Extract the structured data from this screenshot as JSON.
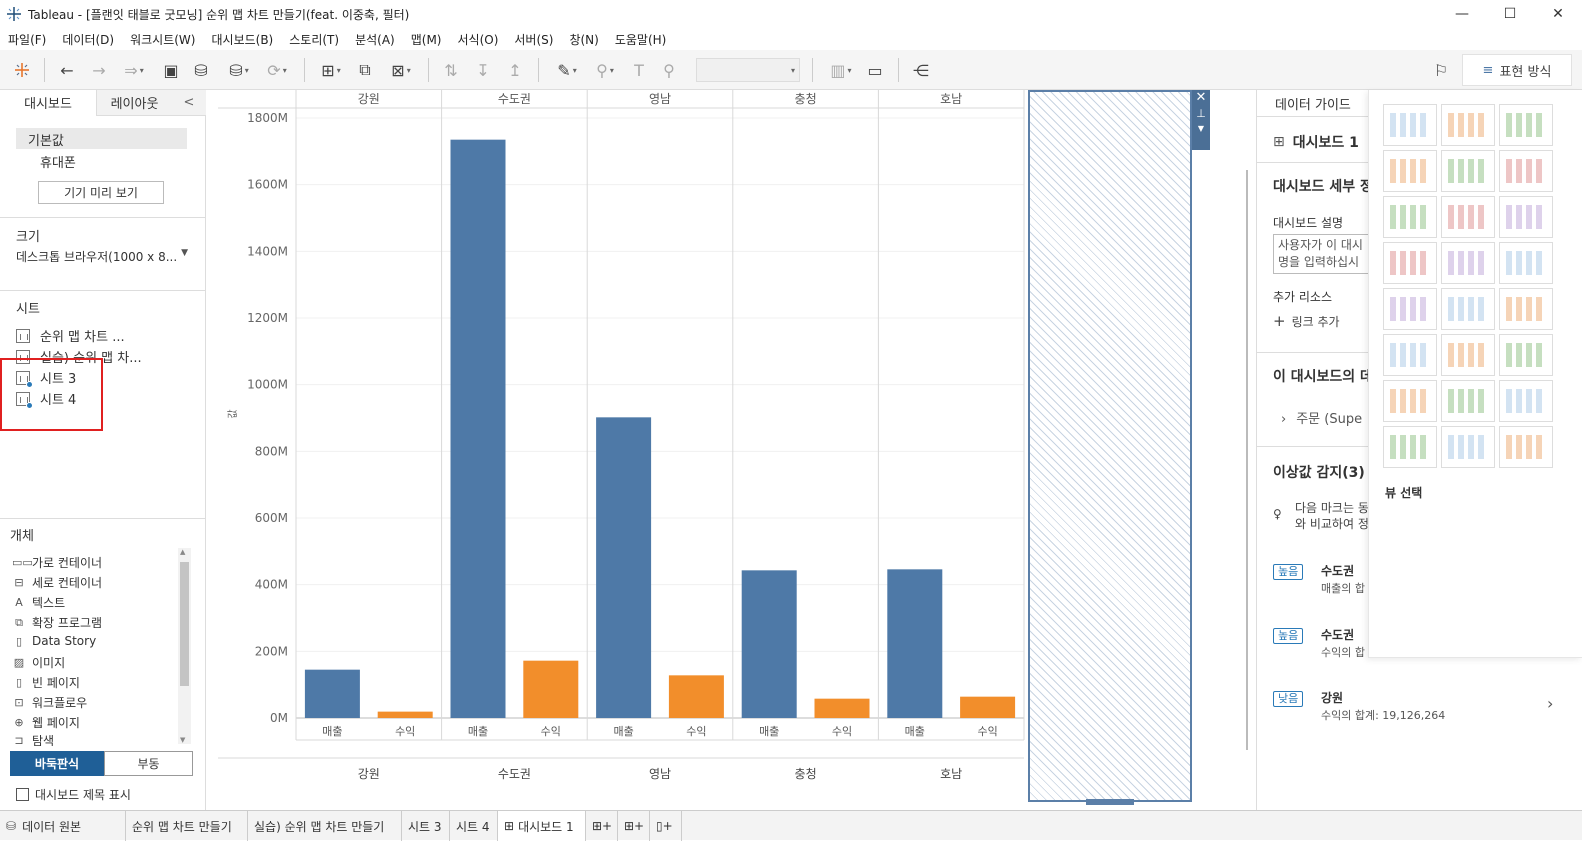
{
  "window": {
    "title": "Tableau - [플랜잇 태블로 굿모닝] 순위 맵 차트 만들기(feat. 이중축, 필터)",
    "min": "—",
    "max": "☐",
    "close": "✕"
  },
  "menu": [
    "파일(F)",
    "데이터(D)",
    "워크시트(W)",
    "대시보드(B)",
    "스토리(T)",
    "분석(A)",
    "맵(M)",
    "서식(O)",
    "서버(S)",
    "창(N)",
    "도움말(H)"
  ],
  "toolbar": {
    "show_me_label": "표현 방식"
  },
  "left": {
    "tab_dashboard": "대시보드",
    "tab_layout": "레이아웃",
    "collapse": "<",
    "device_default": "기본값",
    "device_phone": "휴대폰",
    "device_preview": "기기 미리 보기",
    "size_title": "크기",
    "size_value": "데스크톱 브라우저(1000 x 8...",
    "sheets_title": "시트",
    "sheets": [
      "순위 맵 차트 ...",
      "실습) 순위 맵 차...",
      "시트 3",
      "시트 4"
    ],
    "objects_title": "개체",
    "objects": [
      "가로 컨테이너",
      "세로 컨테이너",
      "텍스트",
      "확장 프로그램",
      "Data Story",
      "이미지",
      "빈 페이지",
      "워크플로우",
      "웹 페이지",
      "탐색"
    ],
    "tiled": "바둑판식",
    "floating": "부동",
    "show_title": "대시보드 제목 표시"
  },
  "chart_data": {
    "type": "bar",
    "categories": [
      "강원",
      "수도권",
      "영남",
      "충청",
      "호남"
    ],
    "subcategories": [
      "매출",
      "수익"
    ],
    "series": [
      {
        "name": "매출",
        "values": [
          145,
          1735,
          902,
          443,
          446
        ]
      },
      {
        "name": "수익",
        "values": [
          19.1,
          172,
          128,
          58,
          64
        ]
      }
    ],
    "y_tick_labels": [
      "0M",
      "200M",
      "400M",
      "600M",
      "800M",
      "1000M",
      "1200M",
      "1400M",
      "1600M",
      "1800M"
    ],
    "ylim": [
      0,
      1800
    ],
    "ylabel": "값",
    "colors": {
      "매출": "#4e79a7",
      "수익": "#f28e2b"
    },
    "grid": true
  },
  "right": {
    "data_guide": "데이터 가이드",
    "dashboard_name": "대시보드 1",
    "details_title": "대시보드 세부 정",
    "desc_label": "대시보드 설명",
    "desc_placeholder_1": "사용자가 이 대시",
    "desc_placeholder_2": "명을 입력하십시",
    "resources": "추가 리소스",
    "add_link": "링크 추가",
    "data_in_dash": "이 대시보드의 데",
    "data_source": "주문 (Supe",
    "outliers_title": "이상값 감지(3)",
    "outlier_hint_1": "다음 마크는 동",
    "outlier_hint_2": "와 비교하여 정",
    "outliers": [
      {
        "badge": "높음",
        "name": "수도권",
        "detail": "매출의 합"
      },
      {
        "badge": "높음",
        "name": "수도권",
        "detail": "수익의 합"
      },
      {
        "badge": "낮음",
        "name": "강원",
        "detail": "수익의 합계: 19,126,264"
      }
    ]
  },
  "showme": {
    "footer": "뷰 선택"
  },
  "bottom_tabs": [
    "데이터 원본",
    "순위 맵 차트 만들기",
    "실습) 순위 맵 차트 만들기",
    "시트 3",
    "시트 4",
    "대시보드 1"
  ]
}
